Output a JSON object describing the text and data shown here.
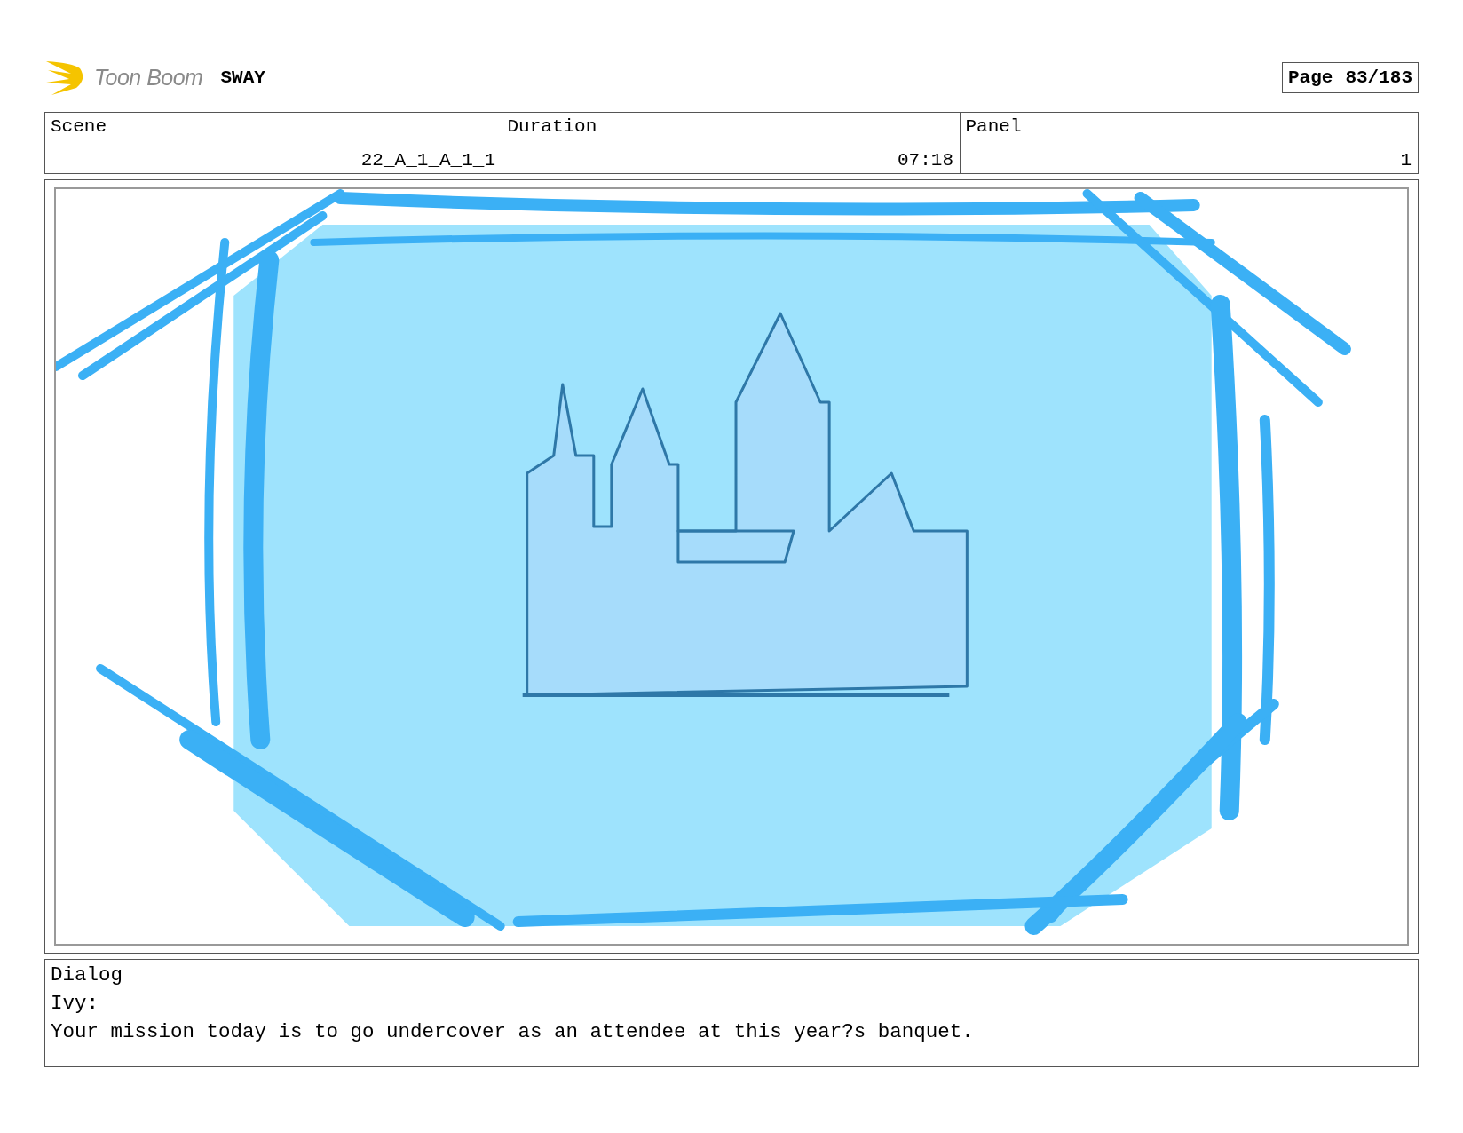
{
  "header": {
    "logo_text": "Toon Boom",
    "project": "SWAY",
    "page_label": "Page",
    "page_number": "83/183"
  },
  "info_table": {
    "columns": [
      "Scene",
      "Duration",
      "Panel"
    ],
    "rows": [
      [
        "22_A_1_A_1_1",
        "07:18",
        "1"
      ]
    ]
  },
  "dialog": {
    "label": "Dialog",
    "speaker": "Ivy:",
    "line": "Your mission today is to go undercover as an attendee at this year?s banquet."
  }
}
